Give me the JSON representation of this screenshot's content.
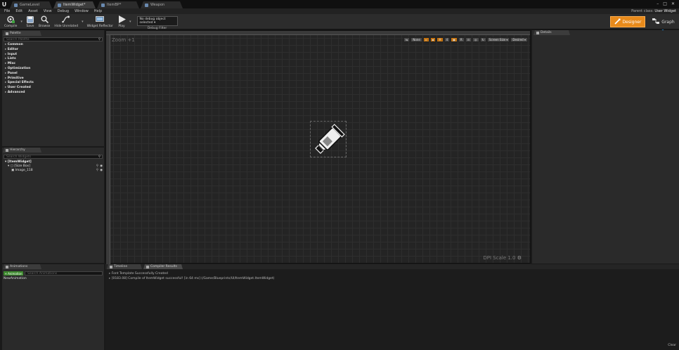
{
  "tabs": [
    {
      "label": "GameLevel",
      "active": false
    },
    {
      "label": "ItemWidget*",
      "active": true
    },
    {
      "label": "ItemBP*",
      "active": false
    },
    {
      "label": "Weapon",
      "active": false
    }
  ],
  "menu": [
    "File",
    "Edit",
    "Asset",
    "View",
    "Debug",
    "Window",
    "Help"
  ],
  "parent_class": {
    "label": "Parent class:",
    "value": "User Widget"
  },
  "toolbar": {
    "buttons": [
      "Compile",
      "Save",
      "Browse",
      "Hide Unrelated",
      "Widget Reflector",
      "Play"
    ],
    "debug_select": "No debug object selected ▾",
    "debug_filter": "Debug Filter",
    "designer": "Designer",
    "graph": "Graph"
  },
  "palette": {
    "tab": "Palette",
    "search_placeholder": "Search Palette",
    "categories": [
      "Common",
      "Editor",
      "Input",
      "Lists",
      "Misc",
      "Optimization",
      "Panel",
      "Primitive",
      "Special Effects",
      "User Created",
      "Advanced"
    ]
  },
  "hierarchy": {
    "tab": "Hierarchy",
    "search_placeholder": "Search Widgets",
    "root": "[ItemWidget]",
    "child": "[Size Box]",
    "leaf": "Image_118"
  },
  "viewport": {
    "zoom": "Zoom +1",
    "dpi": "DPI Scale 1.0",
    "tools": [
      "None",
      "R",
      "Screen Size ▾",
      "Desired ▾"
    ]
  },
  "details": {
    "tab": "Details"
  },
  "animations": {
    "tab": "Animations",
    "add_button": "+ Animation",
    "search_placeholder": "Search Animations",
    "item": "NewAnimation"
  },
  "bottom": {
    "tabs": [
      "Timeline",
      "Compiler Results"
    ],
    "log": [
      "Font Template Successfully Created",
      "[0183.08] Compile of ItemWidget successful! [in 64 ms] (/Game/Blueprints/UI/ItemWidget.ItemWidget)"
    ],
    "clear": "Clear"
  },
  "colors": {
    "accent": "#e88a1b",
    "arrow": "#3aa6f0"
  }
}
